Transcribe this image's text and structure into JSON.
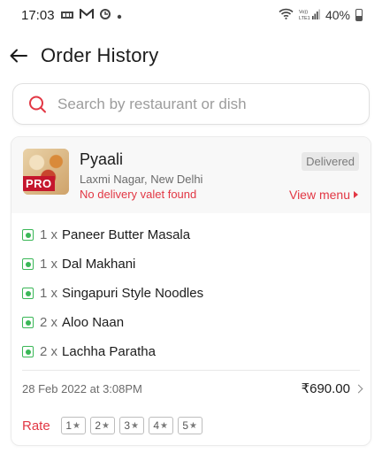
{
  "status_bar": {
    "time": "17:03",
    "network": "Vo)) LTE1",
    "battery": "40%"
  },
  "header": {
    "title": "Order History"
  },
  "search": {
    "placeholder": "Search by restaurant or dish"
  },
  "order": {
    "badge": "PRO",
    "restaurant": "Pyaali",
    "location": "Laxmi Nagar, New Delhi",
    "note": "No delivery valet found",
    "status": "Delivered",
    "view_menu": "View menu",
    "items": [
      {
        "qty": "1 x",
        "name": "Paneer Butter Masala"
      },
      {
        "qty": "1 x",
        "name": "Dal Makhani"
      },
      {
        "qty": "1 x",
        "name": "Singapuri Style Noodles"
      },
      {
        "qty": "2 x",
        "name": "Aloo Naan"
      },
      {
        "qty": "2 x",
        "name": "Lachha Paratha"
      }
    ],
    "date": "28 Feb 2022 at 3:08PM",
    "total": "₹690.00",
    "rate_label": "Rate",
    "ratings": [
      "1",
      "2",
      "3",
      "4",
      "5"
    ]
  },
  "colors": {
    "accent_red": "#e23744",
    "veg_green": "#3ab757",
    "status_gray": "#e8e8e8"
  }
}
